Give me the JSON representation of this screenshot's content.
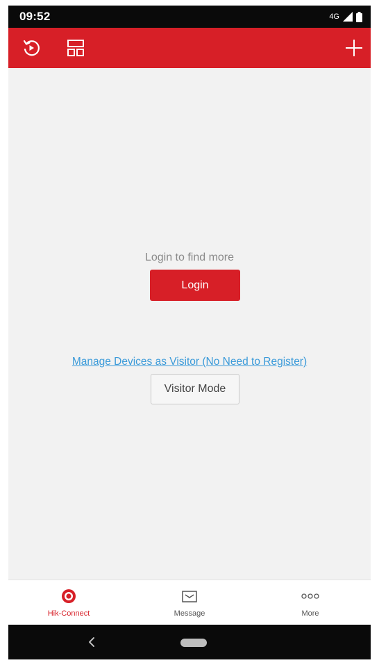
{
  "status_bar": {
    "time": "09:52",
    "network": "4G",
    "icons": [
      "signal-icon",
      "battery-icon"
    ]
  },
  "app_bar": {
    "icons": [
      "replay-icon",
      "layout-icon",
      "add-icon"
    ]
  },
  "main": {
    "prompt": "Login to find more",
    "login_button": "Login",
    "visitor_link": "Manage Devices as Visitor (No Need to Register)",
    "visitor_button": "Visitor Mode"
  },
  "tabs": [
    {
      "label": "Hik-Connect",
      "icon": "hik-connect-icon",
      "active": true
    },
    {
      "label": "Message",
      "icon": "message-icon",
      "active": false
    },
    {
      "label": "More",
      "icon": "more-icon",
      "active": false
    }
  ],
  "nav_bar": {
    "icons": [
      "back-icon",
      "home-pill-icon"
    ]
  },
  "colors": {
    "brand_red": "#d71f27",
    "link_blue": "#3a9ad9",
    "background": "#f2f2f2"
  }
}
